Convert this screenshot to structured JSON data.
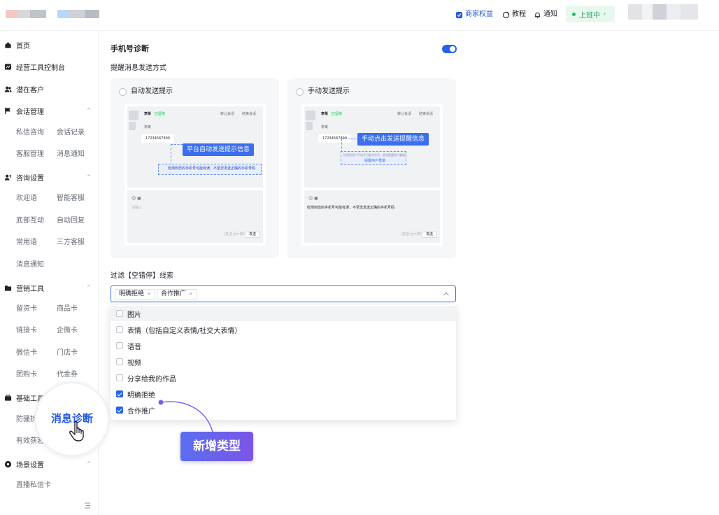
{
  "header": {
    "brand_link": "商家权益",
    "tutorial": "教程",
    "notifications": "通知",
    "status": "上班中",
    "status_arrow": "▾"
  },
  "sidebar": {
    "home": "首页",
    "console": "经营工具控制台",
    "potential_clients": "潜在客户",
    "session_mgmt": "会话管理",
    "private_consult": "私信咨询",
    "session_records": "会话记录",
    "cs_mgmt": "客服管理",
    "msg_notify": "消息通知",
    "consult_settings": "咨询设置",
    "welcome": "欢迎语",
    "smart_cs": "智能客服",
    "bottom_interact": "底部互动",
    "auto_reply": "自动回复",
    "common_phrases": "常用语",
    "third_party_cs": "三方客服",
    "msg_notify2": "消息通知",
    "marketing_tools": "营销工具",
    "lead_card": "留资卡",
    "product_card": "商品卡",
    "link_card": "链接卡",
    "wecom_card": "企微卡",
    "wechat_card": "微信卡",
    "store_card": "门店卡",
    "group_card": "团购卡",
    "voucher": "代金券",
    "basic_tools": "基础工具",
    "anti_harass": "防骚扰",
    "valid_acquire": "有效获客",
    "scene_settings": "场景设置",
    "live_dm_card": "直播私信卡",
    "caret_up": "^"
  },
  "main": {
    "title": "手机号诊断",
    "remind_label": "提醒消息发送方式",
    "auto_option": "自动发送提示",
    "manual_option": "手动发送提示",
    "filter_label": "过滤【空错停】线索",
    "tags": [
      "明确拒绝",
      "合作推广"
    ],
    "tag_remove": "×"
  },
  "preview": {
    "name": "李某",
    "tag": "已留资",
    "transfer": "转让会话",
    "end": "结束会话",
    "phone": "17234567890",
    "time_label": "李某",
    "auto_callout": "平台自动发送提示信息",
    "manual_callout": "手动点击发送提醒信息",
    "warning_text": "检测到您的手机号可能有误，不至您发送正确的手机号码",
    "manual_hint": "检测到用户手机号可能为空号，是否提醒用户重填?",
    "manual_link": "提醒用户重填",
    "input_placeholder": "请输入",
    "counter": "(发送 回=换行)",
    "send": "发送"
  },
  "dropdown": {
    "options": [
      {
        "label": "图片",
        "checked": false
      },
      {
        "label": "表情（包括自定义表情/社交大表情）",
        "checked": false
      },
      {
        "label": "语音",
        "checked": false
      },
      {
        "label": "视频",
        "checked": false
      },
      {
        "label": "分享给我的作品",
        "checked": false
      },
      {
        "label": "明确拒绝",
        "checked": true
      },
      {
        "label": "合作推广",
        "checked": true
      }
    ]
  },
  "annotations": {
    "magnifier_text": "消息诊断",
    "new_type": "新增类型"
  },
  "colors": {
    "accent": "#2563eb",
    "status_green": "#28b865",
    "badge_start": "#5b6ef0",
    "badge_end": "#7b55e6"
  }
}
